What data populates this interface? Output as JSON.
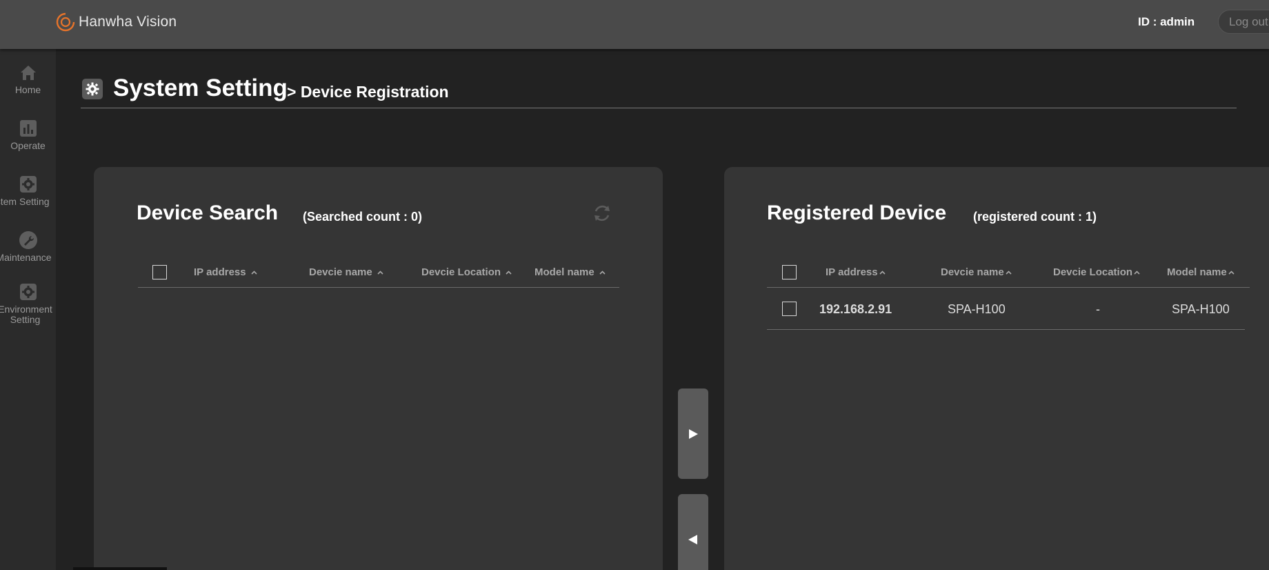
{
  "header": {
    "brand": "Hanwha Vision",
    "user_id": "ID : admin",
    "logout_label": "Log out"
  },
  "sidebar": {
    "items": [
      {
        "label": "Home",
        "icon": "home-icon"
      },
      {
        "label": "Operate",
        "icon": "bar-chart-icon"
      },
      {
        "label": "System Setting",
        "icon": "gear-icon"
      },
      {
        "label": "Maintenance",
        "icon": "wrench-icon"
      },
      {
        "label_line1": "Environment",
        "label_line2": "Setting",
        "icon": "gear-icon"
      }
    ]
  },
  "page": {
    "title": "System Setting",
    "subtitle": "> Device Registration"
  },
  "device_search": {
    "title": "Device Search",
    "count": "(Searched count : 0)",
    "columns": [
      "IP address",
      "Devcie name",
      "Devcie Location",
      "Model name"
    ],
    "rows": []
  },
  "registered_device": {
    "title": "Registered Device",
    "count": "(registered count : 1)",
    "columns": [
      "IP address",
      "Devcie name",
      "Devcie Location",
      "Model name"
    ],
    "rows": [
      {
        "ip": "192.168.2.91",
        "name": "SPA-H100",
        "location": "-",
        "model": "SPA-H100"
      }
    ]
  },
  "transfer": {
    "add_glyph": "▶",
    "remove_glyph": "◀"
  },
  "colors": {
    "background": "#222222",
    "header": "#4a4a4a",
    "sidebar": "#2b2b2b",
    "panel": "#353535",
    "brand_accent": "#e8742a"
  }
}
